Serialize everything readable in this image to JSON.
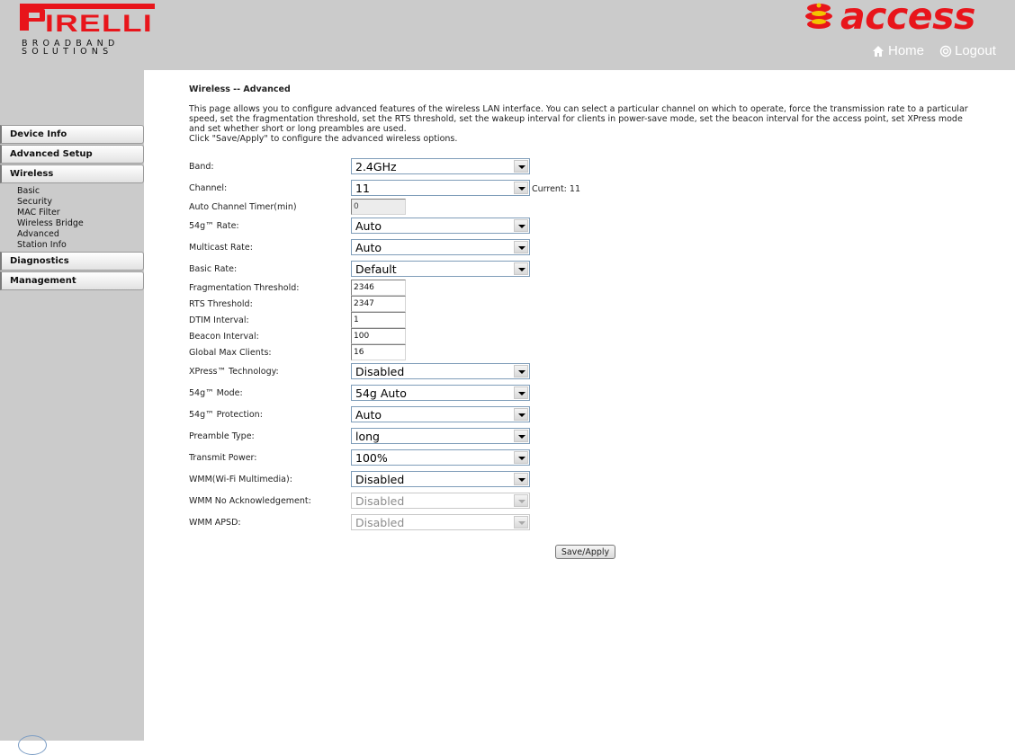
{
  "header": {
    "brand": "PIRELLI",
    "brand_sub": "BROADBAND\nSOLUTIONS",
    "product": "access",
    "home_label": "Home",
    "logout_label": "Logout",
    "colors": {
      "brand_red": "#e8151b",
      "header_bg": "#cbcbcb"
    }
  },
  "sidebar": {
    "device_info": "Device Info",
    "advanced_setup": "Advanced Setup",
    "wireless": "Wireless",
    "wireless_sub": [
      "Basic",
      "Security",
      "MAC Filter",
      "Wireless Bridge",
      "Advanced",
      "Station Info"
    ],
    "diagnostics": "Diagnostics",
    "management": "Management"
  },
  "main": {
    "title": "Wireless -- Advanced",
    "description": "This page allows you to configure advanced features of the wireless LAN interface. You can select a particular channel on which to operate, force the transmission rate to a particular speed, set the fragmentation threshold, set the RTS threshold, set the wakeup interval for clients in power-save mode, set the beacon interval for the access point, set XPress mode and set whether short or long preambles are used.",
    "instruction": "Click \"Save/Apply\" to configure the advanced wireless options.",
    "current_channel": "Current: 11",
    "save_label": "Save/Apply",
    "fields": {
      "band": {
        "label": "Band:",
        "value": "2.4GHz"
      },
      "channel": {
        "label": "Channel:",
        "value": "11"
      },
      "auto_channel_timer": {
        "label": "Auto Channel Timer(min)",
        "value": "0"
      },
      "rate_54g": {
        "label": "54g™ Rate:",
        "value": "Auto"
      },
      "multicast_rate": {
        "label": "Multicast Rate:",
        "value": "Auto"
      },
      "basic_rate": {
        "label": "Basic Rate:",
        "value": "Default"
      },
      "frag_threshold": {
        "label": "Fragmentation Threshold:",
        "value": "2346"
      },
      "rts_threshold": {
        "label": "RTS Threshold:",
        "value": "2347"
      },
      "dtim_interval": {
        "label": "DTIM Interval:",
        "value": "1"
      },
      "beacon_interval": {
        "label": "Beacon Interval:",
        "value": "100"
      },
      "global_max_clients": {
        "label": "Global Max Clients:",
        "value": "16"
      },
      "xpress": {
        "label": "XPress™ Technology:",
        "value": "Disabled"
      },
      "mode_54g": {
        "label": "54g™ Mode:",
        "value": "54g Auto"
      },
      "protection_54g": {
        "label": "54g™ Protection:",
        "value": "Auto"
      },
      "preamble": {
        "label": "Preamble Type:",
        "value": "long"
      },
      "transmit_power": {
        "label": "Transmit Power:",
        "value": "100%"
      },
      "wmm": {
        "label": "WMM(Wi-Fi Multimedia):",
        "value": "Disabled"
      },
      "wmm_no_ack": {
        "label": "WMM No Acknowledgement:",
        "value": "Disabled"
      },
      "wmm_apsd": {
        "label": "WMM APSD:",
        "value": "Disabled"
      }
    }
  }
}
